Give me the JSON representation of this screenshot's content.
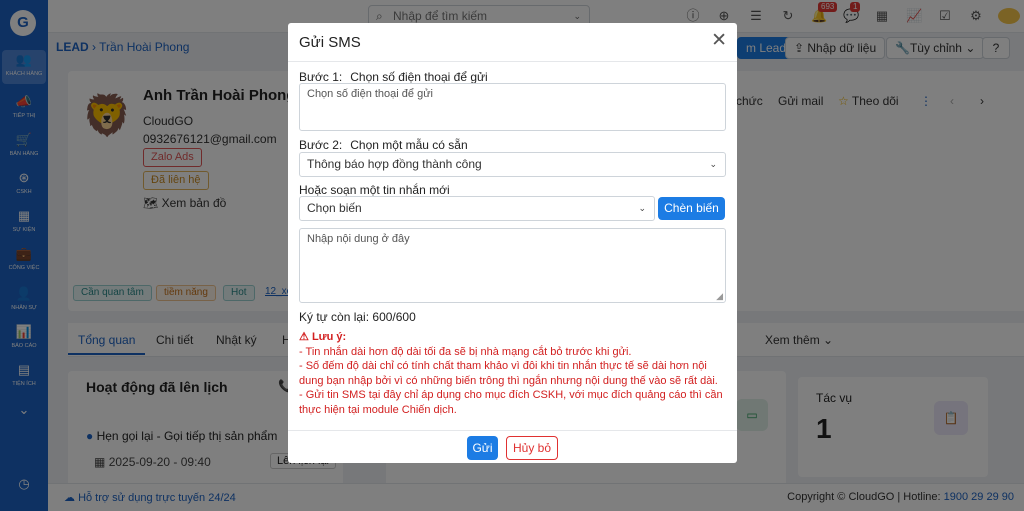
{
  "sidebar": {
    "logo": "G",
    "items": [
      {
        "label": "Khách hàng",
        "icon": "users-icon"
      },
      {
        "label": "Tiếp thị",
        "icon": "megaphone-icon"
      },
      {
        "label": "Bán hàng",
        "icon": "cart-icon"
      },
      {
        "label": "CSKH",
        "icon": "support-icon"
      },
      {
        "label": "Sự kiện",
        "icon": "calendar-icon"
      },
      {
        "label": "Công việc",
        "icon": "briefcase-icon"
      },
      {
        "label": "Nhân sự",
        "icon": "person-icon"
      },
      {
        "label": "Báo cáo",
        "icon": "chart-icon"
      },
      {
        "label": "Tiện ích",
        "icon": "grid-icon"
      }
    ]
  },
  "topbar": {
    "search_placeholder": "Nhập để tìm kiếm",
    "notif_count": "693",
    "chat_count": "1"
  },
  "breadcrumb": {
    "module": "LEAD",
    "current": "Trần Hoài Phong"
  },
  "toolbar": {
    "add_lead": "m Lead",
    "import": "Nhập dữ liệu",
    "customize": "Tùy chỉnh"
  },
  "profile": {
    "name": "Anh Trần Hoài Phong",
    "company": "CloudGO",
    "contact": "0932676121@gmail.com",
    "source_chip": "Zalo Ads",
    "status_chip": "Đã liên hệ",
    "map_link": "Xem bản đồ",
    "tags": [
      "Cần quan tâm",
      "tiềm năng",
      "Hot"
    ],
    "tag_more": "12_xe"
  },
  "actions": {
    "org": "chức",
    "send_mail": "Gửi mail",
    "follow": "Theo dõi"
  },
  "tabs": {
    "overview": "Tổng quan",
    "detail": "Chi tiết",
    "log": "Nhật ký",
    "partial": "H",
    "more": "Xem thêm"
  },
  "schedule": {
    "title": "Hoạt động đã lên lịch",
    "item": "Hẹn gọi lại - Gọi tiếp thị sản phẩm",
    "datetime": "2025-09-20 - 09:40",
    "reschedule": "Lên lịch lại"
  },
  "stats": {
    "task_label": "Tác vụ",
    "task_value": "1"
  },
  "footer": {
    "support": "Hỗ trợ sử dụng trực tuyến 24/24",
    "copyright": "Copyright © CloudGO | Hotline: ",
    "hotline": "1900 29 29 90"
  },
  "modal": {
    "title": "Gửi SMS",
    "step1_label": "Bước 1:",
    "step1_text": "Chọn số điện thoại để gửi",
    "phone_placeholder": "Chọn số điện thoại để gửi",
    "step2_label": "Bước 2:",
    "step2_text": "Chọn một mẫu có sẵn",
    "template_value": "Thông báo hợp đồng thành công",
    "or_compose": "Hoặc soạn một tin nhắn mới",
    "variable_value": "Chọn biến",
    "insert_variable": "Chèn biến",
    "content_placeholder": "Nhập nội dung ở đây",
    "chars_left": "Ký tự còn lại: 600/600",
    "warning_title": "Lưu ý:",
    "warning_lines": [
      "- Tin nhắn dài hơn độ dài tối đa sẽ bị nhà mạng cắt bỏ trước khi gửi.",
      "- Số đếm độ dài chỉ có tính chất tham khảo vì đôi khi tin nhắn thực tế sẽ dài hơn nội dung bạn nhập bởi vì có những biến trông thì ngắn nhưng nội dung thế vào sẽ rất dài.",
      "- Gửi tin SMS tại đây chỉ áp dụng cho mục đích CSKH, với mục đích quảng cáo thì cần thực hiện tại module Chiến dịch."
    ],
    "send": "Gửi",
    "cancel": "Hủy bỏ"
  },
  "colors": {
    "primary": "#1c63c4",
    "button_blue": "#1c7ce4",
    "warning_red": "#d21f1f"
  }
}
